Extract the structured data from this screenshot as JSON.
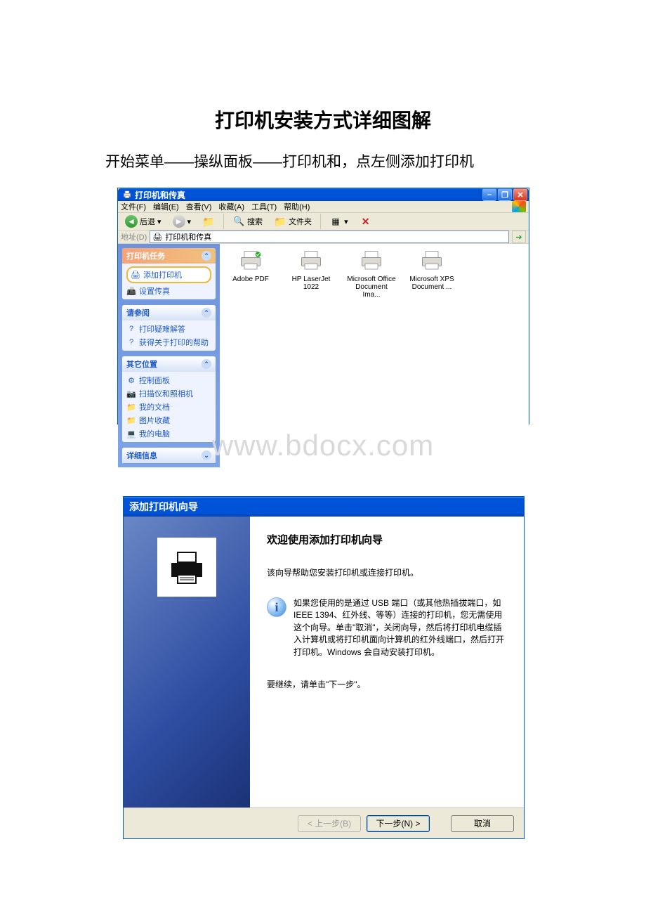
{
  "doc": {
    "title": "打印机安装方式详细图解",
    "sub": "开始菜单——操纵面板——打印机和，点左侧添加打印机",
    "watermark": "www.bdocx.com"
  },
  "win1": {
    "title": "打印机和传真",
    "menu": {
      "file": "文件(F)",
      "edit": "编辑(E)",
      "view": "查看(V)",
      "fav": "收藏(A)",
      "tools": "工具(T)",
      "help": "帮助(H)"
    },
    "toolbar": {
      "back": "后退",
      "search": "搜索",
      "folders": "文件夹"
    },
    "addr": {
      "label": "地址(D)",
      "text": "打印机和传真"
    },
    "tasks_hdr": "打印机任务",
    "tasks": {
      "add": "添加打印机",
      "server": "设置传真"
    },
    "see_hdr": "请参阅",
    "see": {
      "trouble": "打印疑难解答",
      "help": "获得关于打印的帮助"
    },
    "other_hdr": "其它位置",
    "other": {
      "cp": "控制面板",
      "scan": "扫描仪和照相机",
      "docs": "我的文档",
      "pics": "图片收藏",
      "pc": "我的电脑"
    },
    "details_hdr": "详细信息",
    "printers": [
      {
        "name": "Adobe PDF"
      },
      {
        "name": "HP LaserJet 1022"
      },
      {
        "name": "Microsoft Office Document Ima..."
      },
      {
        "name": "Microsoft XPS Document ..."
      }
    ]
  },
  "win2": {
    "title": "添加打印机向导",
    "heading": "欢迎使用添加打印机向导",
    "desc": "该向导帮助您安装打印机或连接打印机。",
    "info": "如果您使用的是通过 USB 端口（或其他热插拔端口，如 IEEE 1394、红外线、等等）连接的打印机，您无需使用这个向导。单击\"取消\"，关闭向导，然后将打印机电缆插入计算机或将打印机面向计算机的红外线端口，然后打开打印机。Windows 会自动安装打印机。",
    "cont": "要继续，请单击\"下一步\"。",
    "btn_prev": "< 上一步(B)",
    "btn_next": "下一步(N) >",
    "btn_cancel": "取消"
  }
}
